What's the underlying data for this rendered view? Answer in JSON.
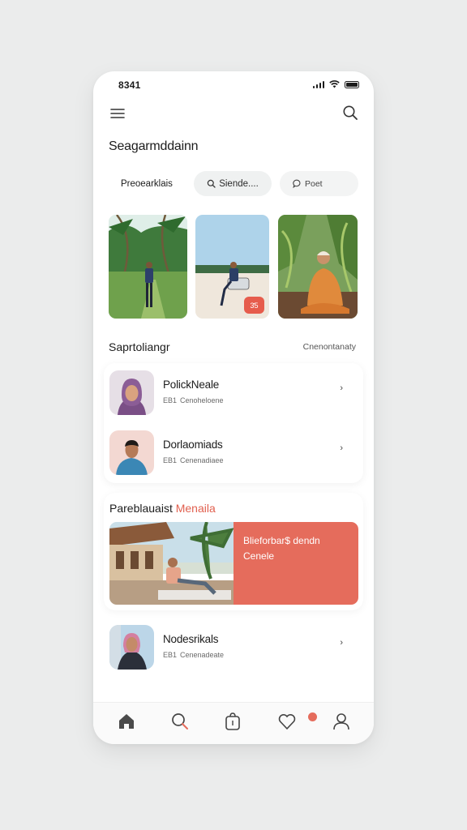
{
  "status_bar": {
    "time": "8341"
  },
  "header": {
    "title": "Seagarmddainn"
  },
  "chips": [
    {
      "label": "Preoearklais"
    },
    {
      "label": "Siende....",
      "icon": "search-icon"
    },
    {
      "label": "Poet",
      "icon": "chat-icon"
    }
  ],
  "photos": [
    {
      "icon": "photo-man-palms"
    },
    {
      "icon": "photo-man-beach-chair",
      "badge": "3̄5"
    },
    {
      "icon": "photo-man-orange-robe"
    }
  ],
  "section": {
    "title": "Saprtoliangr",
    "link": "Cnenontanaty"
  },
  "list": [
    {
      "name": "PolickNeale",
      "meta_code": "EB1",
      "meta_text": "Cenoheloene"
    },
    {
      "name": "Dorlaomiads",
      "meta_code": "EB1",
      "meta_text": "Cenenadiaee"
    }
  ],
  "feature": {
    "title_main": "Pareblauaist",
    "title_accent": "Menaila",
    "panel_line1": "Blieforbar$ dendn",
    "panel_line2": "Cenele"
  },
  "solo_item": {
    "name": "Nodesrikals",
    "meta_code": "EB1",
    "meta_text": "Cenenadeate"
  },
  "tabbar": {
    "items": [
      "home-icon",
      "search-icon",
      "bag-icon",
      "heart-icon",
      "profile-icon"
    ],
    "notification_count": ""
  },
  "colors": {
    "accent": "#e56c5c",
    "background": "#ebecec",
    "chip": "#eff1f1"
  }
}
